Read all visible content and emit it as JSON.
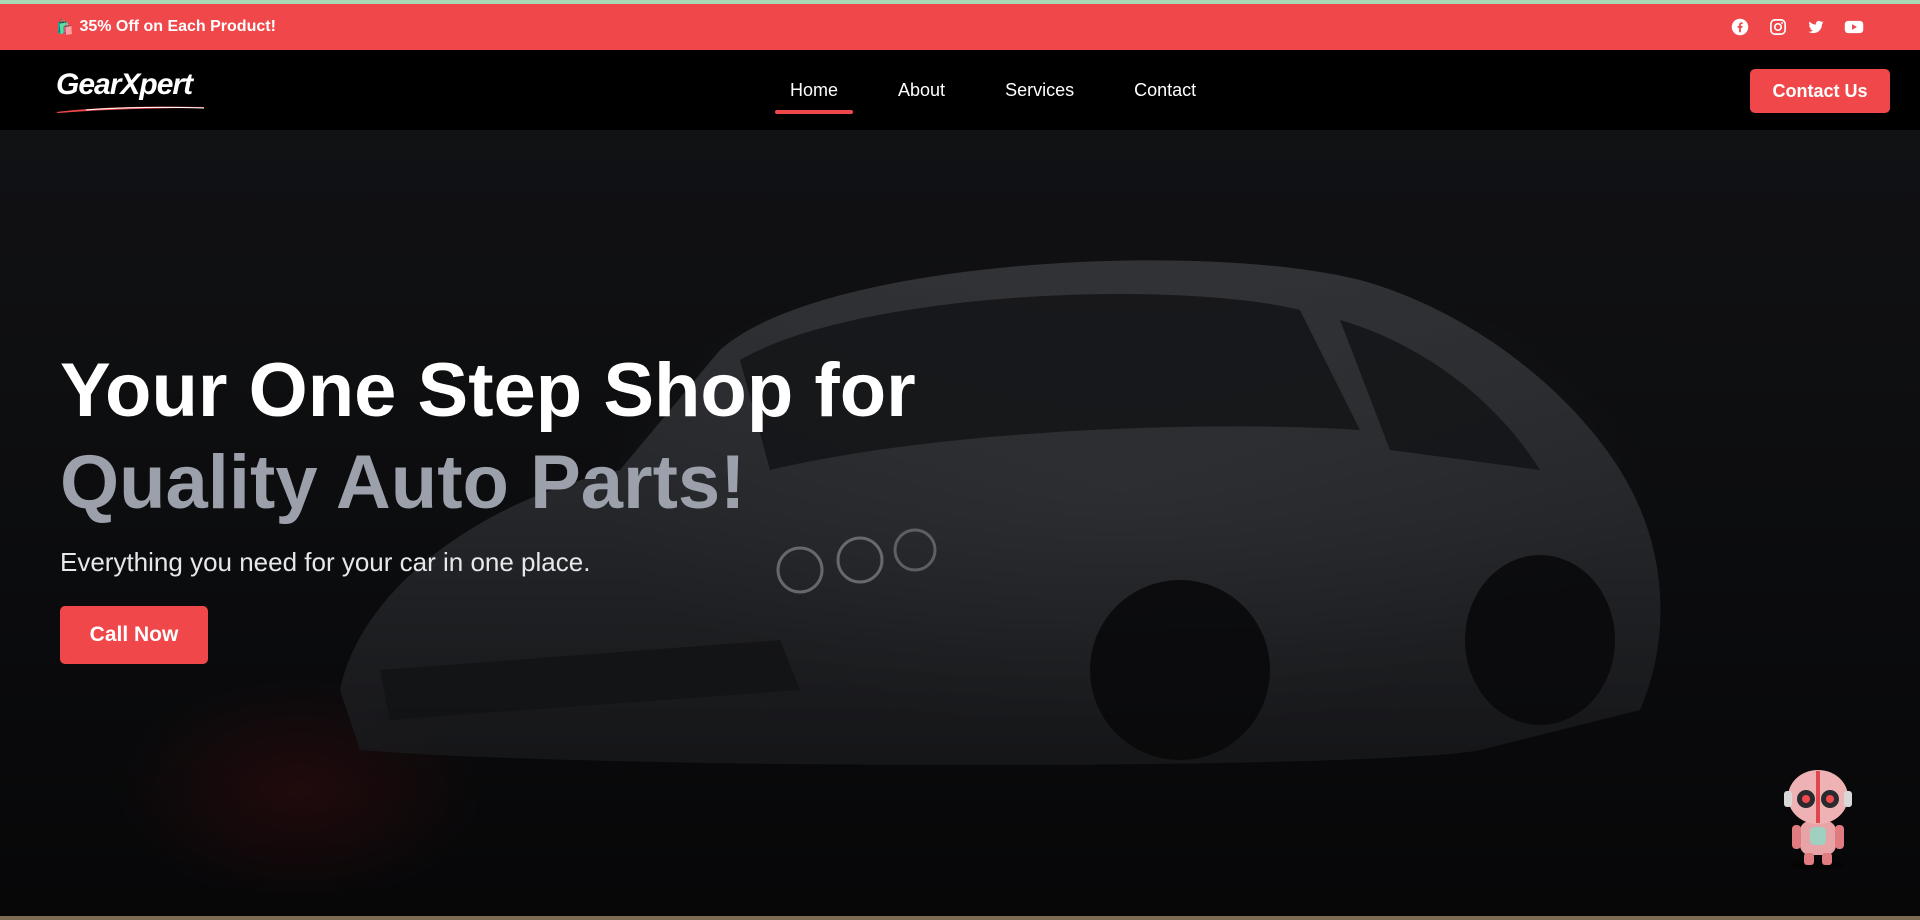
{
  "promo": {
    "emoji": "🛍️",
    "text": "35% Off on Each Product!"
  },
  "social_icons": [
    "facebook-icon",
    "instagram-icon",
    "twitter-icon",
    "youtube-icon"
  ],
  "brand": {
    "logo_text": "GearXpert"
  },
  "nav": {
    "items": [
      {
        "label": "Home",
        "active": true
      },
      {
        "label": "About",
        "active": false
      },
      {
        "label": "Services",
        "active": false
      },
      {
        "label": "Contact",
        "active": false
      }
    ],
    "cta_label": "Contact Us"
  },
  "hero": {
    "title_line1": "Your One Step Shop for",
    "title_line2": "Quality Auto Parts!",
    "subtitle": "Everything you need for your car in one place.",
    "button_label": "Call Now"
  },
  "colors": {
    "accent": "#f0474a",
    "nav_bg": "#000000",
    "muted_title": "#9ba0ab"
  }
}
